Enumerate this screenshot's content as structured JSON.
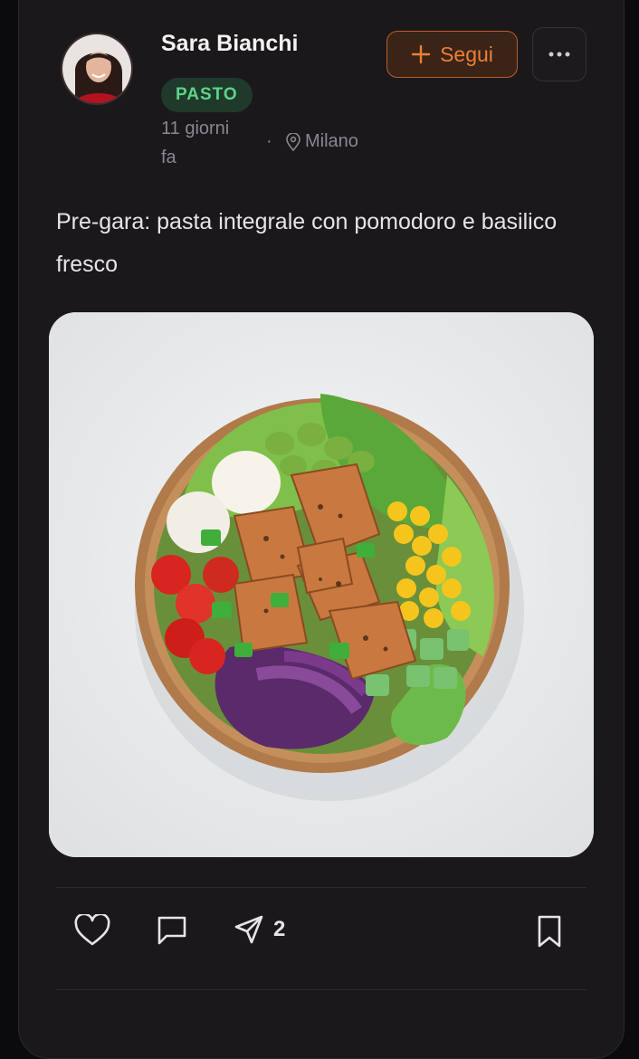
{
  "post": {
    "author": "Sara Bianchi",
    "badge": "PASTO",
    "time": "11 giorni fa",
    "separator": "·",
    "location": "Milano",
    "follow_label": "Segui",
    "caption": "Pre-gara: pasta integrale con pomodoro e basilico fresco",
    "share_count": "2"
  },
  "icons": {
    "location": "map-pin-icon",
    "follow": "plus-icon",
    "more": "more-horizontal-icon",
    "like": "heart-icon",
    "comment": "comment-icon",
    "share": "send-icon",
    "save": "bookmark-icon"
  },
  "colors": {
    "accent": "#f07e34",
    "badge_text": "#5fd389",
    "card_bg": "#1b181b"
  }
}
